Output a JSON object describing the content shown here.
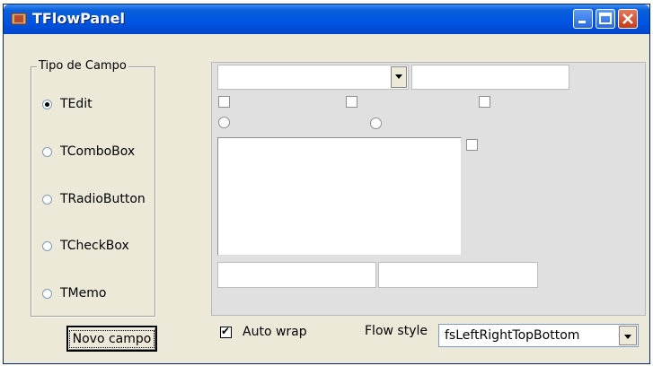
{
  "window": {
    "title": "TFlowPanel"
  },
  "groupbox": {
    "caption": "Tipo de Campo",
    "options": [
      "TEdit",
      "TComboBox",
      "TRadioButton",
      "TCheckBox",
      "TMemo"
    ],
    "selected": "TEdit"
  },
  "buttons": {
    "new_field": "Novo campo"
  },
  "controls": {
    "auto_wrap_label": "Auto wrap",
    "auto_wrap_checked": true,
    "flow_style_label": "Flow style",
    "flow_style_value": "fsLeftRightTopBottom"
  },
  "icons": {
    "minimize": "minimize-icon",
    "maximize": "maximize-icon",
    "close": "close-icon"
  }
}
